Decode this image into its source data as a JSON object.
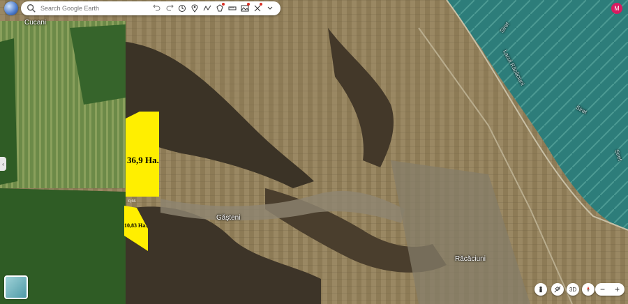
{
  "search": {
    "placeholder": "Search Google Earth"
  },
  "toolbar": {
    "items": [
      "undo-icon",
      "redo-icon",
      "history-icon",
      "pin-icon",
      "path-icon",
      "polygon-icon",
      "ruler-icon",
      "image-icon",
      "measure-icon",
      "chevron-down-icon"
    ]
  },
  "account": {
    "initial": "M"
  },
  "places": {
    "cucani": "Cucani",
    "gasteni": "Găşteni",
    "racaciuni": "Răcăciuni",
    "lake": "Lacul Răcăciuni",
    "siret1": "Siret",
    "siret2": "Siret",
    "siret3": "Siret"
  },
  "parcels": {
    "large": "36,9 Ha.",
    "small": "10,83 Ha.",
    "tiny": "0,66"
  },
  "controls": {
    "three_d": "3D",
    "compass": "N",
    "zoom_out": "−",
    "zoom_in": "+",
    "side_tab": "‹"
  },
  "colors": {
    "parcel": "#ffef00",
    "water": "#2a7a78",
    "field": "#8a7a55",
    "forest": "#2c5a23"
  }
}
